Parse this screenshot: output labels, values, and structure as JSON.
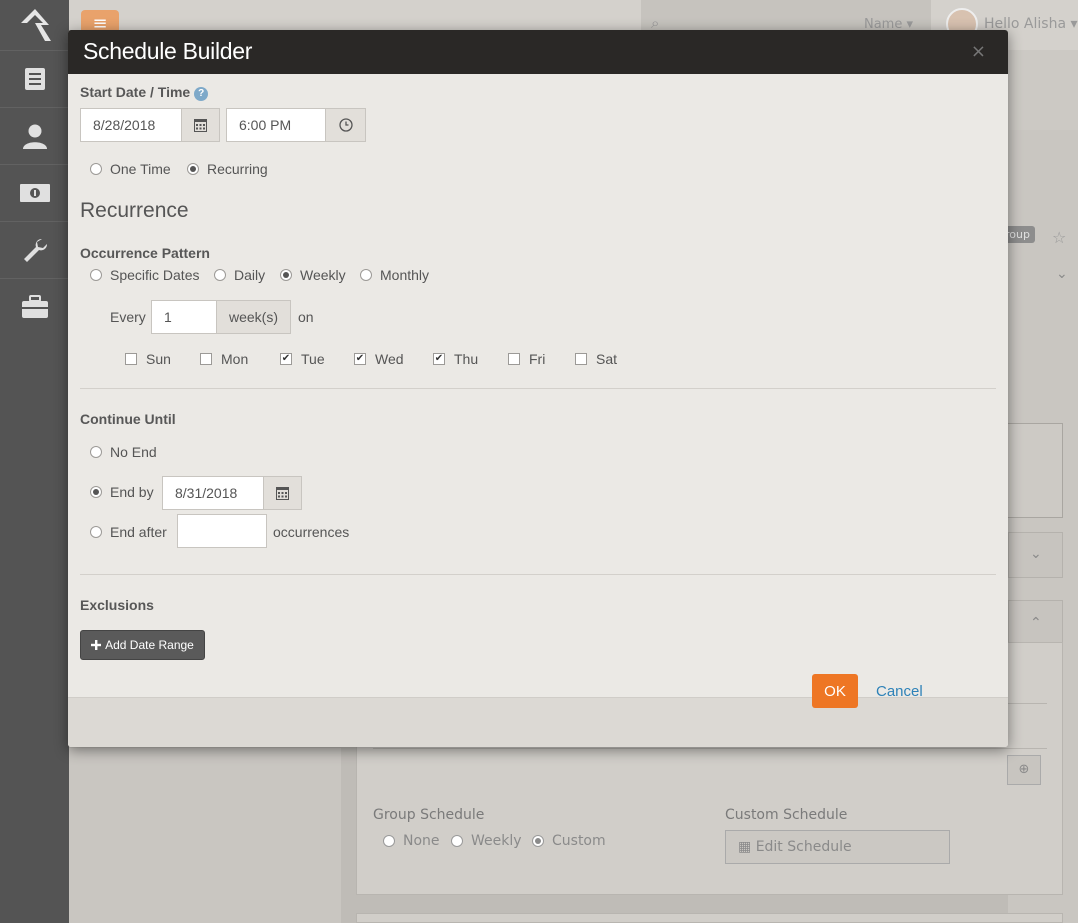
{
  "background": {
    "search_scope": "Name",
    "greeting": "Hello Alisha",
    "tag": "roup",
    "group_schedule_label": "Group Schedule",
    "custom_schedule_label": "Custom Schedule",
    "schedule_options": [
      "None",
      "Weekly",
      "Custom"
    ],
    "edit_schedule": "Edit Schedule"
  },
  "modal": {
    "title": "Schedule Builder",
    "close": "×",
    "start_label": "Start Date / Time",
    "start_date": "8/28/2018",
    "start_time": "6:00 PM",
    "type_options": [
      "One Time",
      "Recurring"
    ],
    "type_selected": "Recurring",
    "recurrence_heading": "Recurrence",
    "occurrence_label": "Occurrence Pattern",
    "pattern_options": [
      "Specific Dates",
      "Daily",
      "Weekly",
      "Monthly"
    ],
    "pattern_selected": "Weekly",
    "every_label": "Every",
    "every_value": "1",
    "weeks_label": "week(s)",
    "on_label": "on",
    "days": [
      {
        "label": "Sun",
        "checked": false
      },
      {
        "label": "Mon",
        "checked": false
      },
      {
        "label": "Tue",
        "checked": true
      },
      {
        "label": "Wed",
        "checked": true
      },
      {
        "label": "Thu",
        "checked": true
      },
      {
        "label": "Fri",
        "checked": false
      },
      {
        "label": "Sat",
        "checked": false
      }
    ],
    "continue_label": "Continue Until",
    "no_end": "No End",
    "end_by": "End by",
    "end_by_date": "8/31/2018",
    "end_after": "End after",
    "end_after_value": "",
    "occurrences": "occurrences",
    "exclusions_label": "Exclusions",
    "add_range": "Add Date Range",
    "ok": "OK",
    "cancel": "Cancel"
  }
}
